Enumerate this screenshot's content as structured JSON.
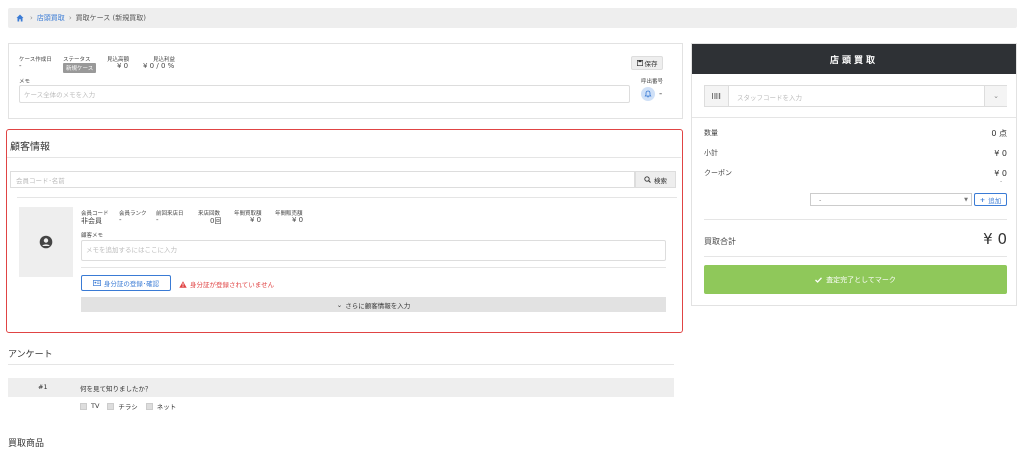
{
  "breadcrumb": {
    "home": "店頭買取",
    "current": "買取ケース (新規買取)"
  },
  "case": {
    "created_label": "ケース作成日",
    "created_value": "-",
    "status_label": "ステータス",
    "status_badge": "新規ケース",
    "estimate_label": "見込高額",
    "estimate_value": "¥ 0",
    "profit_label": "見込利益",
    "profit_value": "¥ 0 / 0 %",
    "save_label": "保存",
    "memo_label": "メモ",
    "memo_placeholder": "ケース全体のメモを入力",
    "call_label": "呼出番号",
    "call_value": "-"
  },
  "customer": {
    "title": "顧客情報",
    "search_placeholder": "会員コード･名前",
    "search_button": "検索",
    "fields": [
      {
        "label": "会員コード",
        "value": "非会員"
      },
      {
        "label": "会員ランク",
        "value": "-"
      },
      {
        "label": "前回来店日",
        "value": "-"
      },
      {
        "label": "来店回数",
        "value": "0回"
      },
      {
        "label": "年間買取額",
        "value": "¥ 0"
      },
      {
        "label": "年間販売額",
        "value": "¥ 0"
      }
    ],
    "memo_label": "顧客メモ",
    "memo_placeholder": "メモを追加するにはここに入力",
    "id_button": "身分証の登録･確認",
    "id_warning": "身分証が登録されていません",
    "more_button": "さらに顧客情報を入力"
  },
  "survey": {
    "title": "アンケート",
    "number": "#1",
    "question": "何を見て知りましたか？",
    "options": [
      "TV",
      "チラシ",
      "ネット"
    ]
  },
  "items": {
    "title": "買取商品"
  },
  "right": {
    "title": "店頭買取",
    "staff_placeholder": "スタッフコードを入力",
    "qty_label": "数量",
    "qty_value": "0 点",
    "subtotal_label": "小計",
    "subtotal_value": "¥ 0",
    "coupon_label": "クーポン",
    "coupon_value": "¥ 0",
    "coupon_sub": "-",
    "coupon_select": "-",
    "add_label": "追加",
    "total_label": "買取合計",
    "total_value": "¥ 0",
    "complete_button": "査定完了としてマーク"
  },
  "colors": {
    "accent": "#3a7bd5",
    "danger": "#e04444",
    "success": "#8fc85a",
    "header": "#2e3135"
  }
}
